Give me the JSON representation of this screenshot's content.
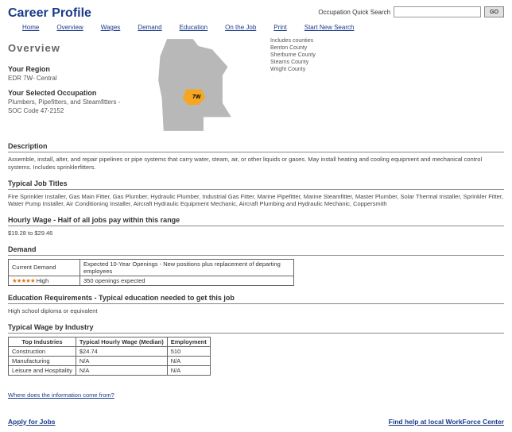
{
  "header": {
    "title": "Career Profile",
    "search_label": "Occupation Quick Search",
    "search_placeholder": "",
    "go_label": "GO"
  },
  "nav": [
    "Home",
    "Overview",
    "Wages",
    "Demand",
    "Education",
    "On the Job",
    "Print",
    "Start New Search"
  ],
  "overview": {
    "heading": "Overview",
    "region_label": "Your Region",
    "region_value": "EDR 7W- Central",
    "occupation_label": "Your Selected Occupation",
    "occupation_value": "Plumbers, Pipefitters, and Steamfitters - SOC Code 47-2152",
    "map_region_code": "7W",
    "counties_header": "Includes counties",
    "counties": [
      "Benton County",
      "Sherburne County",
      "Stearns County",
      "Wright County"
    ]
  },
  "sections": {
    "description": {
      "title": "Description",
      "text": "Assemble, install, alter, and repair pipelines or pipe systems that carry water, steam, air, or other liquids or gases. May install heating and cooling equipment and mechanical control systems. Includes sprinklerfitters."
    },
    "job_titles": {
      "title": "Typical Job Titles",
      "text": "Fire Sprinkler Installer, Gas Main Fitter, Gas Plumber, Hydraulic Plumber, Industrial Gas Fitter, Marine Pipefitter, Marine Steamfitter, Master Plumber, Solar Thermal Installer, Sprinkler Fitter, Water Pump Installer, Air Conditioning Installer, Aircraft Hydraulic Equipment Mechanic, Aircraft Plumbing and Hydraulic Mechanic, Coppersmith"
    },
    "wage": {
      "title": "Hourly Wage - Half of all jobs pay within this range",
      "text": "$19.28 to $29.46"
    },
    "demand": {
      "title": "Demand",
      "col1": "Current Demand",
      "col2": "Expected 10-Year Openings - New positions plus replacement of departing employees",
      "rating_stars": "★★★★★",
      "rating_text": "High",
      "openings": "350 openings expected"
    },
    "education": {
      "title": "Education Requirements - Typical education needed to get this job",
      "text": "High school diploma or equivalent"
    },
    "wage_industry": {
      "title": "Typical Wage by Industry",
      "headers": [
        "Top Industries",
        "Typical Hourly Wage (Median)",
        "Employment"
      ],
      "rows": [
        [
          "Construction",
          "$24.74",
          "510"
        ],
        [
          "Manufacturing",
          "N/A",
          "N/A"
        ],
        [
          "Leisure and Hospitality",
          "N/A",
          "N/A"
        ]
      ]
    }
  },
  "footer": {
    "info_link": "Where does the information come from?",
    "apply": "Apply for Jobs",
    "find_help": "Find help at local WorkForce Center"
  }
}
